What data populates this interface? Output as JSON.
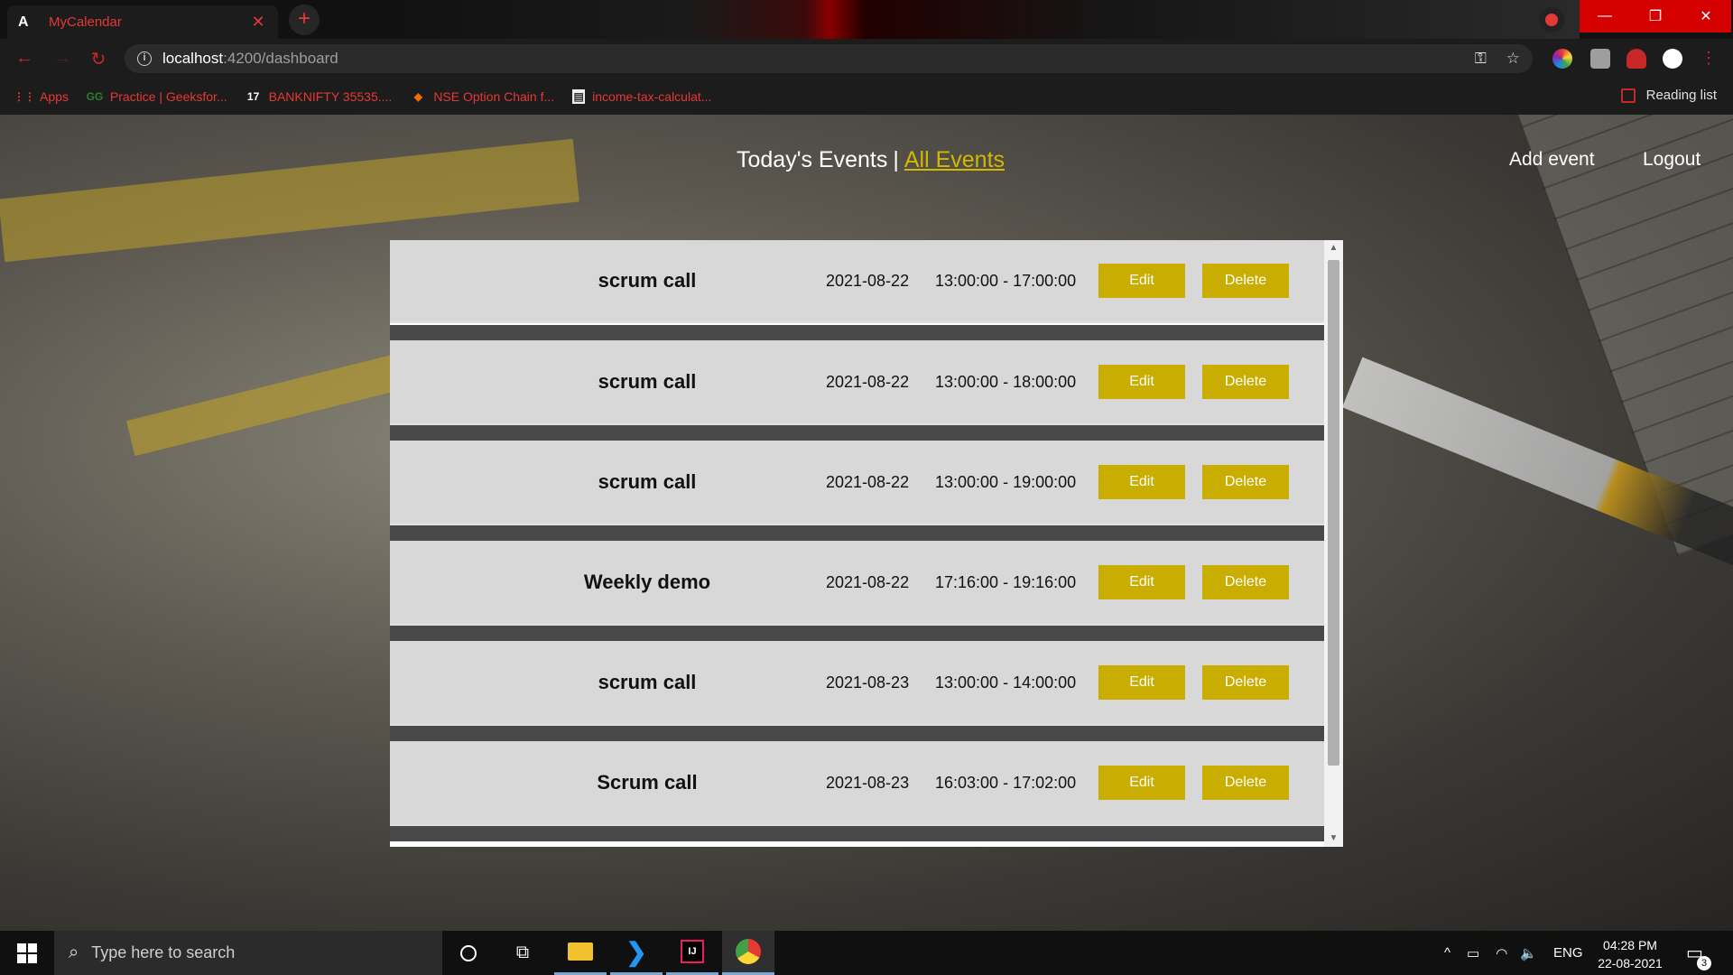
{
  "browser": {
    "tab_title": "MyCalendar",
    "tab_favicon": "A",
    "url_host": "localhost",
    "url_path": ":4200/dashboard",
    "bookmarks": [
      {
        "label": "Apps",
        "icon": "apps-grid-icon"
      },
      {
        "label": "Practice | Geeksfor...",
        "icon": "gfg-icon"
      },
      {
        "label": "BANKNIFTY 35535....",
        "icon": "tradingview-icon"
      },
      {
        "label": "NSE Option Chain f...",
        "icon": "nse-icon"
      },
      {
        "label": "income-tax-calculat...",
        "icon": "document-icon"
      }
    ],
    "reading_list": "Reading list",
    "accent": "#e53935"
  },
  "nav": {
    "today": "Today's Events",
    "separator": "|",
    "all": "All Events",
    "add_event": "Add event",
    "logout": "Logout"
  },
  "events": {
    "edit_label": "Edit",
    "delete_label": "Delete",
    "items": [
      {
        "name": "scrum call",
        "date": "2021-08-22",
        "time": "13:00:00 - 17:00:00"
      },
      {
        "name": "scrum call",
        "date": "2021-08-22",
        "time": "13:00:00 - 18:00:00"
      },
      {
        "name": "scrum call",
        "date": "2021-08-22",
        "time": "13:00:00 - 19:00:00"
      },
      {
        "name": "Weekly demo",
        "date": "2021-08-22",
        "time": "17:16:00 - 19:16:00"
      },
      {
        "name": "scrum call",
        "date": "2021-08-23",
        "time": "13:00:00 - 14:00:00"
      },
      {
        "name": "Scrum call",
        "date": "2021-08-23",
        "time": "16:03:00 - 17:02:00"
      }
    ],
    "button_color": "#c9ad00"
  },
  "taskbar": {
    "search_placeholder": "Type here to search",
    "language": "ENG",
    "time": "04:28 PM",
    "date": "22-08-2021",
    "notification_count": "3"
  }
}
